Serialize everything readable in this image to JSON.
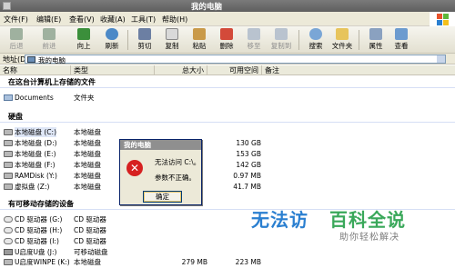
{
  "window": {
    "title": "我的电脑"
  },
  "menu": {
    "items": [
      "文件(F)",
      "编辑(E)",
      "查看(V)",
      "收藏(A)",
      "工具(T)",
      "帮助(H)"
    ]
  },
  "toolbar": {
    "back": "后退",
    "forward": "前进",
    "up": "向上",
    "refresh": "刷新",
    "cut": "剪切",
    "copy": "复制",
    "paste": "粘贴",
    "delete": "删除",
    "move_to": "移至",
    "copy_to": "复制到",
    "search": "搜索",
    "folders": "文件夹",
    "properties": "属性",
    "views": "查看"
  },
  "address": {
    "label": "地址(D)",
    "value": "我的电脑"
  },
  "columns": {
    "name": "名称",
    "type": "类型",
    "total": "总大小",
    "free": "可用空间",
    "note": "备注"
  },
  "groups": {
    "files": "在这台计算机上存储的文件",
    "hdd": "硬盘",
    "removable": "有可移动存储的设备"
  },
  "rows_files": [
    {
      "name": "Documents",
      "type": "文件夹",
      "total": "",
      "free": ""
    }
  ],
  "rows_hdd": [
    {
      "name": "本地磁盘 (C:)",
      "type": "本地磁盘",
      "total": "",
      "free": ""
    },
    {
      "name": "本地磁盘 (D:)",
      "type": "本地磁盘",
      "total": "",
      "free": "130 GB"
    },
    {
      "name": "本地磁盘 (E:)",
      "type": "本地磁盘",
      "total": "",
      "free": "153 GB"
    },
    {
      "name": "本地磁盘 (F:)",
      "type": "本地磁盘",
      "total": "",
      "free": "142 GB"
    },
    {
      "name": "RAMDisk (Y:)",
      "type": "本地磁盘",
      "total": "",
      "free": "0.97 MB"
    },
    {
      "name": "虚拟盘 (Z:)",
      "type": "本地磁盘",
      "total": "",
      "free": "41.7 MB"
    }
  ],
  "rows_removable": [
    {
      "name": "CD 驱动器 (G:)",
      "type": "CD 驱动器",
      "total": "",
      "free": ""
    },
    {
      "name": "CD 驱动器 (H:)",
      "type": "CD 驱动器",
      "total": "",
      "free": ""
    },
    {
      "name": "CD 驱动器 (I:)",
      "type": "CD 驱动器",
      "total": "",
      "free": ""
    },
    {
      "name": "U启度U盘 (J:)",
      "type": "可移动磁盘",
      "total": "",
      "free": ""
    },
    {
      "name": "U启度WINPE (K:)",
      "type": "本地磁盘",
      "total": "279 MB",
      "free": "223 MB"
    }
  ],
  "dialog": {
    "title": "我的电脑",
    "message1": "无法访问 C:\\。",
    "message2": "参数不正确。",
    "ok": "确定"
  },
  "watermark": {
    "part1": "无法访",
    "part2": "百科全说",
    "sub": "助你轻松解决"
  },
  "colors": {
    "accent_blue": "#2a7fd0",
    "accent_green": "#3aa85a",
    "error_red": "#d62020"
  }
}
